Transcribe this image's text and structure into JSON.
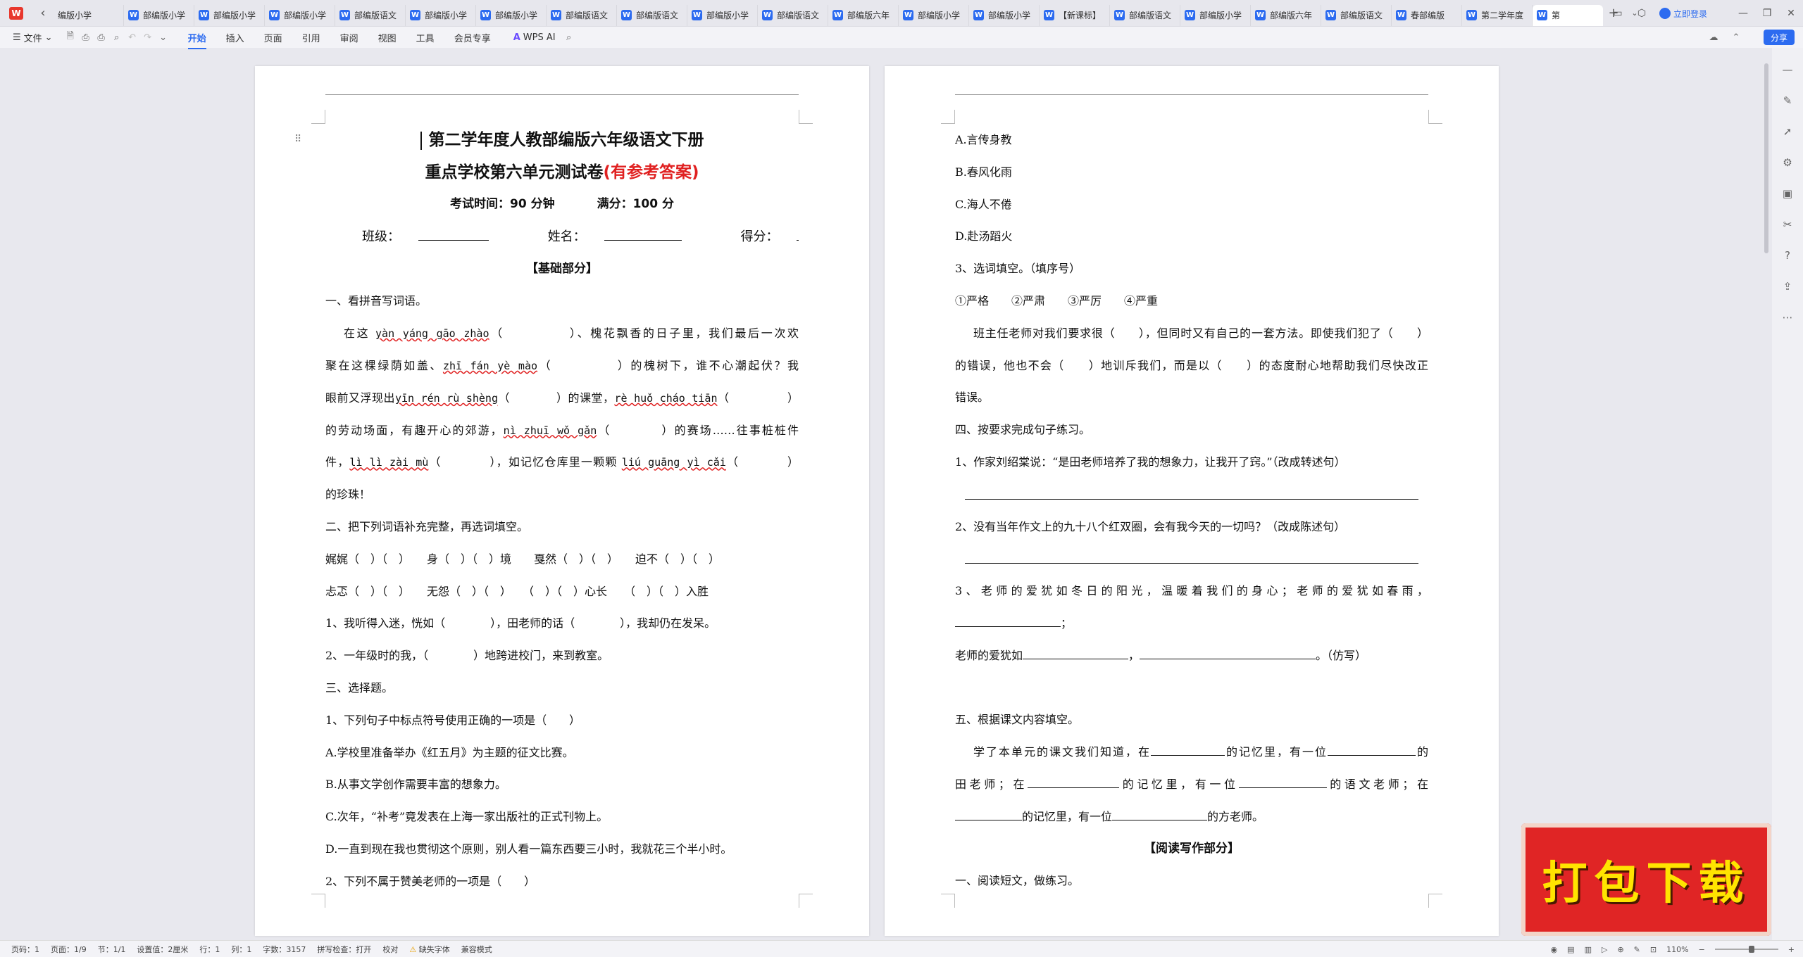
{
  "tabs": [
    {
      "label": "编版小学"
    },
    {
      "label": "部编版小学"
    },
    {
      "label": "部编版小学"
    },
    {
      "label": "部编版小学"
    },
    {
      "label": "部编版语文"
    },
    {
      "label": "部编版小学"
    },
    {
      "label": "部编版小学"
    },
    {
      "label": "部编版语文"
    },
    {
      "label": "部编版语文"
    },
    {
      "label": "部编版小学"
    },
    {
      "label": "部编版语文"
    },
    {
      "label": "部编版六年"
    },
    {
      "label": "部编版小学"
    },
    {
      "label": "部编版小学"
    },
    {
      "label": "【新课标】"
    },
    {
      "label": "部编版语文"
    },
    {
      "label": "部编版小学"
    },
    {
      "label": "部编版六年"
    },
    {
      "label": "部编版语文"
    },
    {
      "label": "春部编版"
    },
    {
      "label": "第二学年度"
    },
    {
      "label": "第"
    }
  ],
  "topbar": {
    "login": "立即登录",
    "share": "分享"
  },
  "ribbon": {
    "file": "文件",
    "menus": [
      "开始",
      "插入",
      "页面",
      "引用",
      "审阅",
      "视图",
      "工具",
      "会员专享"
    ],
    "ai": "WPS AI"
  },
  "page1": {
    "title1": "第二学年度人教部编版六年级语文下册",
    "title2a": "重点学校第六单元测试卷",
    "title2b": "(有参考答案)",
    "time": "考试时间：90 分钟",
    "score": "满分：100 分",
    "class_label": "班级：",
    "name_label": "姓名：",
    "get_label": "得分：",
    "section": "【基础部分】",
    "q1": "一、看拼音写词语。",
    "l1a": "在这 ",
    "l1py1": "yàn yáng gāo zhào",
    "l1b": "（　　　　　）、槐花飘香的日子里，我们最后一次欢",
    "l2a": "聚在这棵绿荫如盖、",
    "l2py1": "zhī fán yè mào",
    "l2b": "（　　　　　）的槐树下，谁不心潮起伏？我",
    "l3a": "眼前又浮现出",
    "l3py1": "yīn rén rù shèng",
    "l3b": "（　　　　）的课堂，",
    "l3py2": "rè huǒ cháo tiān",
    "l3c": "（　　　　　）",
    "l4a": "的劳动场面，有趣开心的郊游，",
    "l4py1": "nì zhuī wǒ gǎn",
    "l4b": "（　　　　）的赛场……往事桩桩件",
    "l5a": "件，",
    "l5py1": "lì lì zài mù",
    "l5b": "（　　　　），如记忆仓库里一颗颗 ",
    "l5py2": "liú guāng yì cǎi",
    "l5c": "（　　　　）",
    "l6": "的珍珠！",
    "q2": "二、把下列词语补充完整，再选词填空。",
    "w1": "娓娓（　）（　）　　身（　）（　）境　　戛然（　）（　）　　迫不（　）（　）",
    "w2": "忐忑（　）（　）　　无怨（　）（　）　　（　）（　）心长　　（　）（　）入胜",
    "w3": "1、我听得入迷，恍如（　　　　），田老师的话（　　　　），我却仍在发呆。",
    "w4": "2、一年级时的我，（　　　　）地跨进校门，来到教室。",
    "q3": "三、选择题。",
    "c1": "1、下列句子中标点符号使用正确的一项是（　　）",
    "c1a": "A.学校里准备举办《红五月》为主题的征文比赛。",
    "c1b": "B.从事文学创作需要丰富的想象力。",
    "c1c": "C.次年，“补考”竟发表在上海一家出版社的正式刊物上。",
    "c1d": "D.一直到现在我也贯彻这个原则，别人看一篇东西要三小时，我就花三个半小时。",
    "c2": "2、下列不属于赞美老师的一项是（　　）"
  },
  "page2": {
    "a": "A.言传身教",
    "b": "B.春风化雨",
    "c": "C.海人不倦",
    "d": "D.赴汤蹈火",
    "q3": "3、选词填空。（填序号）",
    "opts": "①严格　　②严肃　　③严厉　　④严重",
    "p1": "班主任老师对我们要求很（　　），但同时又有自己的一套方法。即使我们犯了（　　）",
    "p2": "的错误，他也不会（　　）地训斥我们，而是以（　　）的态度耐心地帮助我们尽快改正",
    "p3": "错误。",
    "q4": "四、按要求完成句子练习。",
    "s1": "1、作家刘绍棠说：“是田老师培养了我的想象力，让我开了窍。”（改成转述句）",
    "s2": "2、没有当年作文上的九十八个红双圈，会有我今天的一切吗？（改成陈述句）",
    "s3": "3、老师的爱犹如冬日的阳光，温暖着我们的身心；老师的爱犹如春雨，",
    "s3end": "；",
    "s4a": "老师的爱犹如",
    "s4b": "，",
    "s4c": "。（仿写）",
    "q5": "五、根据课文内容填空。",
    "f1a": "学了本单元的课文我们知道，在",
    "f1b": "的记忆里，有一位",
    "f1c": "的",
    "f2a": "田老师；在",
    "f2b": "的记忆里，有一位",
    "f2c": "的语文老师；在",
    "f3a": "的记忆里，有一位",
    "f3b": "的方老师。",
    "sec2": "【阅读写作部分】",
    "r1": "一、阅读短文，做练习。"
  },
  "promo": "打包下载",
  "status": {
    "page": "页码：1",
    "pages": "页面：1/9",
    "section": "节：1/1",
    "setting": "设置值：2厘米",
    "row": "行：1",
    "col": "列：1",
    "words": "字数：3157",
    "spell": "拼写检查：打开",
    "proof": "校对",
    "font": "缺失字体",
    "compat": "兼容模式",
    "zoom": "110%"
  }
}
